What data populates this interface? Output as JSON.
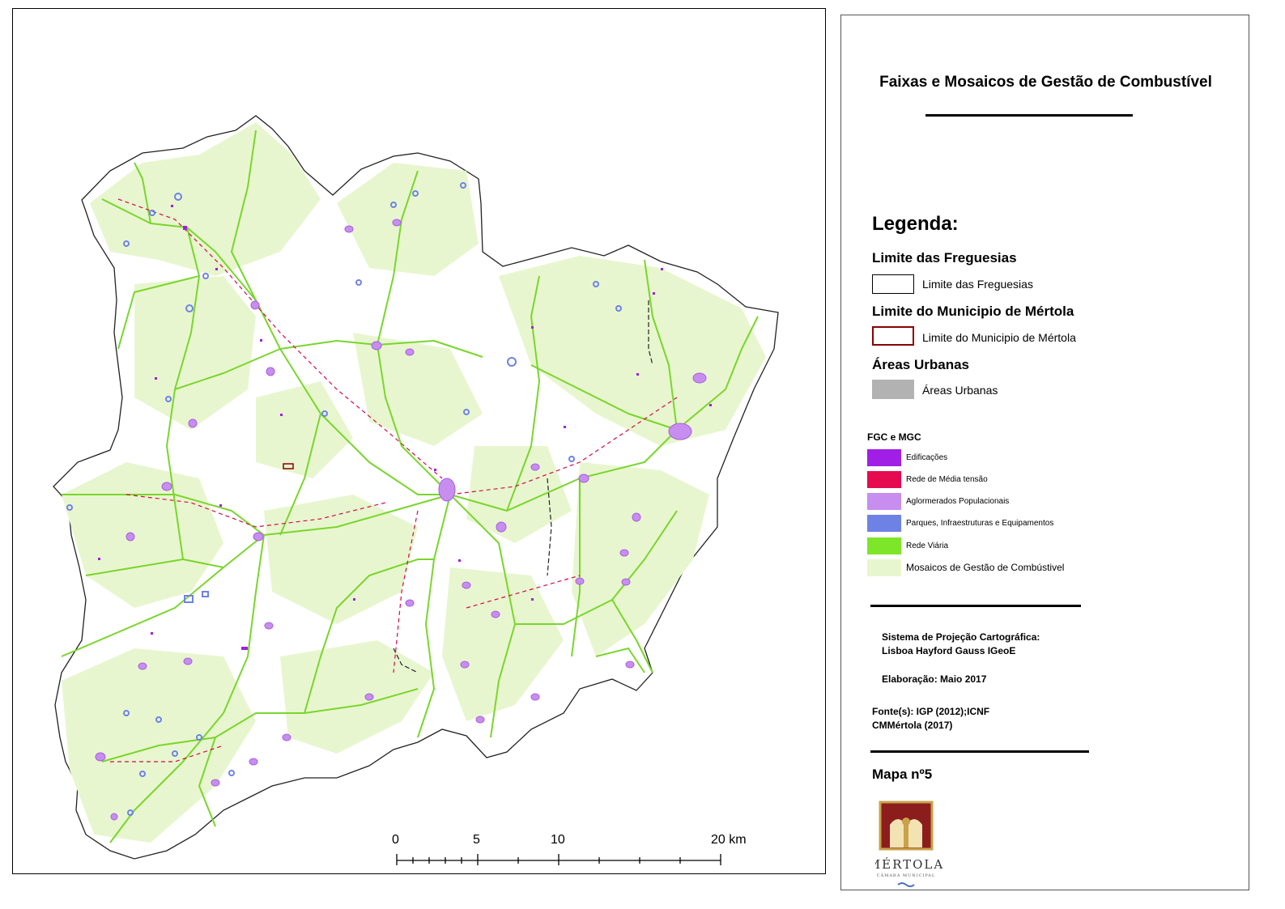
{
  "title": "Faixas e Mosaicos de Gestão de Combustível",
  "legend": {
    "heading": "Legenda:",
    "sections": [
      {
        "title": "Limite das Freguesias",
        "label": "Limite das Freguesias"
      },
      {
        "title": "Limite do Municipio de Mértola",
        "label": "Limite do Municipio de Mértola"
      },
      {
        "title": "Áreas Urbanas",
        "label": "Áreas Urbanas"
      }
    ],
    "fgc_heading": "FGC e MGC",
    "fgc_items": [
      {
        "label": "Edificações",
        "color": "#a01ee6"
      },
      {
        "label": "Rede de Média tensão",
        "color": "#e60a50"
      },
      {
        "label": "Aglormerados Populacionais",
        "color": "#c78ef0"
      },
      {
        "label": "Parques, Infraestruturas e Equipamentos",
        "color": "#6e82e6"
      },
      {
        "label": "Rede Viária",
        "color": "#7de628"
      },
      {
        "label": "Mosaicos de Gestão de Combústivel",
        "color": "#e8f6cf"
      }
    ],
    "colors": {
      "freguesia_border": "#000000",
      "municipio_border": "#8b0000",
      "urban_fill": "#b2b2b2"
    }
  },
  "info": {
    "projection_label": "Sistema de Projeção Cartográfica:",
    "projection_value": "Lisboa Hayford Gauss IGeoE",
    "elaboration": "Elaboração: Maio 2017",
    "source_line1": "Fonte(s): IGP (2012);ICNF",
    "source_line2": "CMMértola (2017)"
  },
  "map_number": "Mapa nº5",
  "logo": {
    "name": "MÉRTOLA",
    "subtitle": "CÂMARA MUNICIPAL"
  },
  "scale_bar": {
    "labels": [
      "0",
      "5",
      "10",
      "20 km"
    ]
  }
}
